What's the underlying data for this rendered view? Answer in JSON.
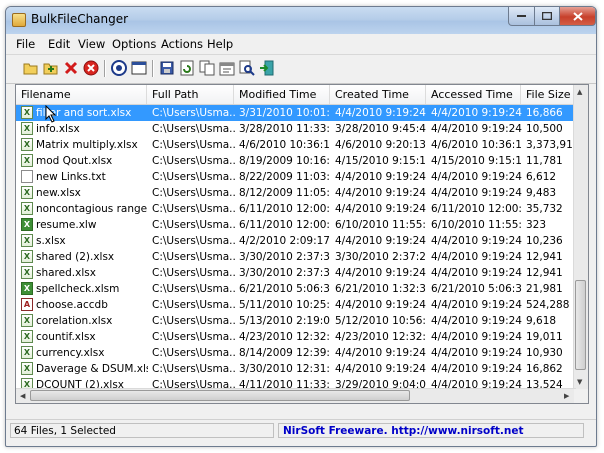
{
  "window": {
    "title": "BulkFileChanger"
  },
  "menu": [
    "File",
    "Edit",
    "View",
    "Options",
    "Actions",
    "Help"
  ],
  "toolbar": [
    "open-folder-icon",
    "add-files-icon",
    "delete-icon",
    "clear-all-icon",
    "properties-icon",
    "window-icon",
    "save-icon",
    "refresh-icon",
    "copy-icon",
    "change-time-icon",
    "find-icon",
    "exit-icon"
  ],
  "columns": [
    "Filename",
    "Full Path",
    "Modified Time",
    "Created Time",
    "Accessed Time",
    "File Size"
  ],
  "rows": [
    {
      "icon": "xlsx",
      "name": "filter and sort.xlsx",
      "path": "C:\\Users\\Usma...",
      "modified": "3/31/2010 10:01:...",
      "created": "4/4/2010 9:19:24 ...",
      "accessed": "4/4/2010 9:19:24 ...",
      "size": "16,866",
      "selected": true
    },
    {
      "icon": "xlsx",
      "name": "info.xlsx",
      "path": "C:\\Users\\Usma...",
      "modified": "3/28/2010 11:33:...",
      "created": "3/28/2010 9:45:4...",
      "accessed": "4/4/2010 9:19:24 ...",
      "size": "10,500"
    },
    {
      "icon": "xlsx",
      "name": "Matrix multiply.xlsx",
      "path": "C:\\Users\\Usma...",
      "modified": "4/6/2010 10:36:1...",
      "created": "4/6/2010 9:20:13 ...",
      "accessed": "4/6/2010 10:36:1...",
      "size": "3,373,916"
    },
    {
      "icon": "xlsx",
      "name": "mod Qout.xlsx",
      "path": "C:\\Users\\Usma...",
      "modified": "8/19/2009 10:16:...",
      "created": "4/15/2010 9:15:1...",
      "accessed": "4/15/2010 9:15:1...",
      "size": "11,781"
    },
    {
      "icon": "txt",
      "name": "new Links.txt",
      "path": "C:\\Users\\Usma...",
      "modified": "8/22/2009 11:03:...",
      "created": "4/4/2010 9:19:24 ...",
      "accessed": "4/4/2010 9:19:24 ...",
      "size": "6,612"
    },
    {
      "icon": "xlsx",
      "name": "new.xlsx",
      "path": "C:\\Users\\Usma...",
      "modified": "8/12/2009 11:05:...",
      "created": "4/4/2010 9:19:24 ...",
      "accessed": "4/4/2010 9:19:24 ...",
      "size": "9,483"
    },
    {
      "icon": "xlsx",
      "name": "noncontagious range...",
      "path": "C:\\Users\\Usma...",
      "modified": "6/11/2010 12:00:...",
      "created": "4/4/2010 9:19:24 ...",
      "accessed": "6/11/2010 12:00:...",
      "size": "35,732"
    },
    {
      "icon": "xlw",
      "name": "resume.xlw",
      "path": "C:\\Users\\Usma...",
      "modified": "6/11/2010 12:00:...",
      "created": "6/10/2010 11:55:...",
      "accessed": "6/10/2010 11:55:...",
      "size": "323"
    },
    {
      "icon": "xlsx",
      "name": "s.xlsx",
      "path": "C:\\Users\\Usma...",
      "modified": "4/2/2010 2:09:17 ...",
      "created": "4/4/2010 9:19:24 ...",
      "accessed": "4/4/2010 9:19:24 ...",
      "size": "10,236"
    },
    {
      "icon": "xlsx",
      "name": "shared (2).xlsx",
      "path": "C:\\Users\\Usma...",
      "modified": "3/30/2010 2:37:3...",
      "created": "3/30/2010 2:37:2...",
      "accessed": "4/4/2010 9:19:24 ...",
      "size": "12,941"
    },
    {
      "icon": "xlsx",
      "name": "shared.xlsx",
      "path": "C:\\Users\\Usma...",
      "modified": "3/30/2010 2:37:3...",
      "created": "4/4/2010 9:19:24 ...",
      "accessed": "4/4/2010 9:19:24 ...",
      "size": "12,941"
    },
    {
      "icon": "xlw",
      "name": "spellcheck.xlsm",
      "path": "C:\\Users\\Usma...",
      "modified": "6/21/2010 5:06:3...",
      "created": "6/21/2010 1:32:3...",
      "accessed": "6/21/2010 5:06:3...",
      "size": "21,981"
    },
    {
      "icon": "accdb",
      "name": "choose.accdb",
      "path": "C:\\Users\\Usma...",
      "modified": "5/11/2010 10:25:...",
      "created": "4/4/2010 9:19:24 ...",
      "accessed": "4/4/2010 9:19:24 ...",
      "size": "524,288"
    },
    {
      "icon": "xlsx",
      "name": "corelation.xlsx",
      "path": "C:\\Users\\Usma...",
      "modified": "5/13/2010 2:19:0...",
      "created": "5/12/2010 10:56:...",
      "accessed": "4/4/2010 9:19:24 ...",
      "size": "9,618"
    },
    {
      "icon": "xlsx",
      "name": "countif.xlsx",
      "path": "C:\\Users\\Usma...",
      "modified": "4/23/2010 12:32:...",
      "created": "4/23/2010 12:32:...",
      "accessed": "4/4/2010 9:19:24 ...",
      "size": "19,011"
    },
    {
      "icon": "xlsx",
      "name": "currency.xlsx",
      "path": "C:\\Users\\Usma...",
      "modified": "8/14/2009 12:39:...",
      "created": "4/4/2010 9:19:24 ...",
      "accessed": "4/4/2010 9:19:24 ...",
      "size": "10,930"
    },
    {
      "icon": "xlsx",
      "name": "Daverage & DSUM.xlsx",
      "path": "C:\\Users\\Usma...",
      "modified": "3/30/2010 12:31:...",
      "created": "4/4/2010 9:19:24 ...",
      "accessed": "4/4/2010 9:19:24 ...",
      "size": "16,862"
    },
    {
      "icon": "xlsx",
      "name": "DCOUNT (2).xlsx",
      "path": "C:\\Users\\Usma...",
      "modified": "4/11/2010 11:33:...",
      "created": "3/29/2010 9:04:0...",
      "accessed": "4/4/2010 9:19:24 ...",
      "size": "13,524"
    }
  ],
  "status": {
    "count": "64 Files, 1 Selected",
    "link": "NirSoft Freeware.  http://www.nirsoft.net"
  }
}
